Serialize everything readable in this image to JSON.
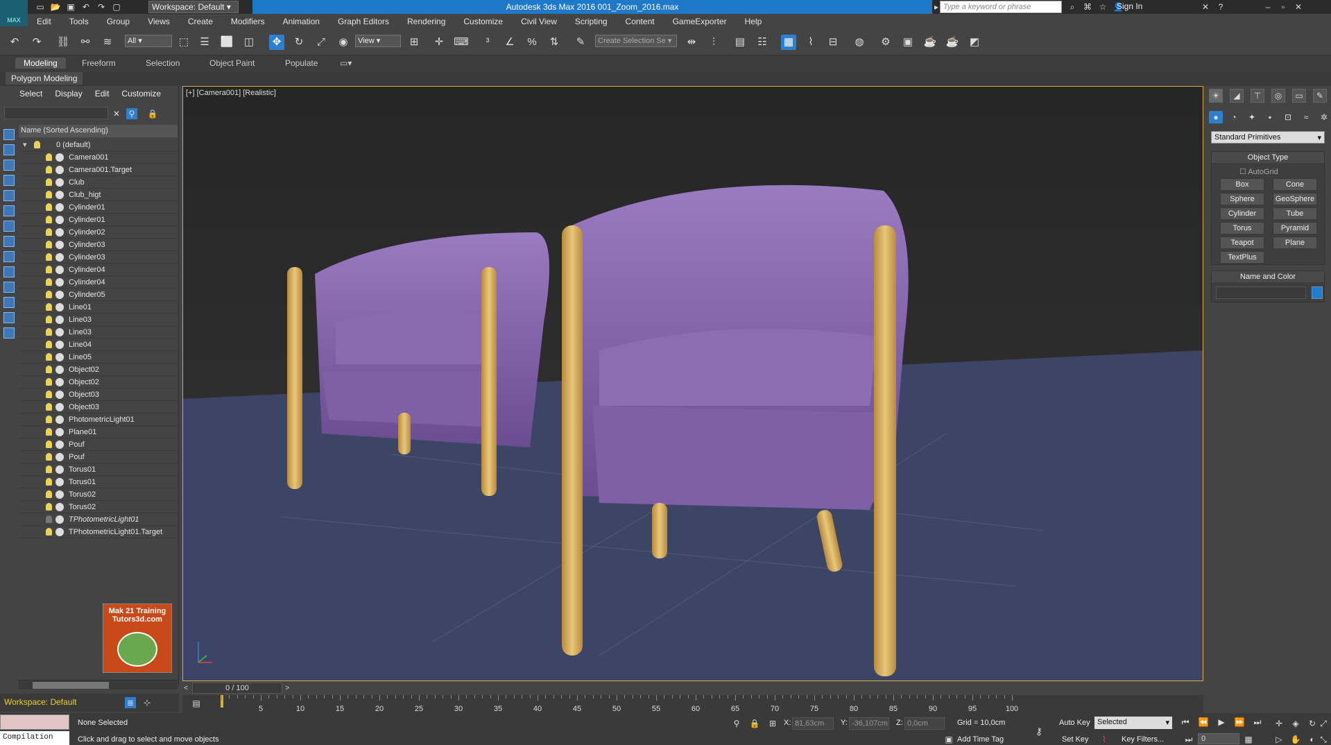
{
  "app": {
    "logo_label": "MAX",
    "workspace": "Workspace: Default",
    "title": "Autodesk 3ds Max 2016     001_Zoom_2016.max",
    "search_placeholder": "Type a keyword or phrase",
    "sign_in": "Sign In"
  },
  "menu": [
    "Edit",
    "Tools",
    "Group",
    "Views",
    "Create",
    "Modifiers",
    "Animation",
    "Graph Editors",
    "Rendering",
    "Customize",
    "Civil View",
    "Scripting",
    "Content",
    "GameExporter",
    "Help"
  ],
  "toolbar": {
    "selection_filter": "All",
    "reference_coord": "View",
    "named_selection_placeholder": "Create Selection Se"
  },
  "ribbon": {
    "tabs": [
      "Modeling",
      "Freeform",
      "Selection",
      "Object Paint",
      "Populate"
    ],
    "active_tab": "Modeling",
    "sub": "Polygon Modeling"
  },
  "explorer": {
    "menu": [
      "Select",
      "Display",
      "Edit",
      "Customize"
    ],
    "header": "Name (Sorted Ascending)",
    "layer": "0 (default)",
    "items": [
      {
        "name": "Camera001",
        "bulb": true
      },
      {
        "name": "Camera001.Target",
        "bulb": true
      },
      {
        "name": "Club",
        "bulb": true
      },
      {
        "name": "Club_higt",
        "bulb": true
      },
      {
        "name": "Cylinder01",
        "bulb": true
      },
      {
        "name": "Cylinder01",
        "bulb": true
      },
      {
        "name": "Cylinder02",
        "bulb": true
      },
      {
        "name": "Cylinder03",
        "bulb": true
      },
      {
        "name": "Cylinder03",
        "bulb": true
      },
      {
        "name": "Cylinder04",
        "bulb": true
      },
      {
        "name": "Cylinder04",
        "bulb": true
      },
      {
        "name": "Cylinder05",
        "bulb": true
      },
      {
        "name": "Line01",
        "bulb": true
      },
      {
        "name": "Line03",
        "bulb": true
      },
      {
        "name": "Line03",
        "bulb": true
      },
      {
        "name": "Line04",
        "bulb": true
      },
      {
        "name": "Line05",
        "bulb": true
      },
      {
        "name": "Object02",
        "bulb": true
      },
      {
        "name": "Object02",
        "bulb": true
      },
      {
        "name": "Object03",
        "bulb": true
      },
      {
        "name": "Object03",
        "bulb": true
      },
      {
        "name": "PhotometricLight01",
        "bulb": true
      },
      {
        "name": "Plane01",
        "bulb": true
      },
      {
        "name": "Pouf",
        "bulb": true
      },
      {
        "name": "Pouf",
        "bulb": true
      },
      {
        "name": "Torus01",
        "bulb": true
      },
      {
        "name": "Torus01",
        "bulb": true
      },
      {
        "name": "Torus02",
        "bulb": true
      },
      {
        "name": "Torus02",
        "bulb": true
      },
      {
        "name": "TPhotometricLight01",
        "bulb": false,
        "italic": true
      },
      {
        "name": "TPhotometricLight01.Target",
        "bulb": true
      }
    ],
    "promo_line1": "Mak 21 Training",
    "promo_line2": "Tutors3d.com",
    "workspace_bottom": "Workspace: Default"
  },
  "viewport": {
    "label": "[+] [Camera001] [Realistic]"
  },
  "timeline": {
    "slider": "0 / 100",
    "ticks": [
      "5",
      "10",
      "15",
      "20",
      "25",
      "30",
      "35",
      "40",
      "45",
      "50",
      "55",
      "60",
      "65",
      "70",
      "75",
      "80",
      "85",
      "90",
      "95",
      "100"
    ]
  },
  "command_panel": {
    "dropdown": "Standard Primitives",
    "object_type_title": "Object Type",
    "autogrid": "AutoGrid",
    "primitives": [
      "Box",
      "Cone",
      "Sphere",
      "GeoSphere",
      "Cylinder",
      "Tube",
      "Torus",
      "Pyramid",
      "Teapot",
      "Plane",
      "TextPlus"
    ],
    "name_color_title": "Name and Color",
    "swatch_color": "#1a7fd6"
  },
  "status": {
    "compile_label": "Compilation",
    "selected": "None Selected",
    "hint": "Click and drag to select and move objects",
    "x": "81,63cm",
    "y": "-36,107cm",
    "z": "0,0cm",
    "grid": "Grid = 10,0cm",
    "add_time_tag": "Add Time Tag",
    "auto_key": "Auto Key",
    "set_key": "Set Key",
    "selected_dd": "Selected",
    "key_filters": "Key Filters...",
    "frame": "0"
  },
  "colors": {
    "accent": "#2f7fd0",
    "viewport_border": "#d7b040",
    "chair": "#8a6ab0",
    "wood": "#d6a957",
    "floor": "#3c4462"
  }
}
